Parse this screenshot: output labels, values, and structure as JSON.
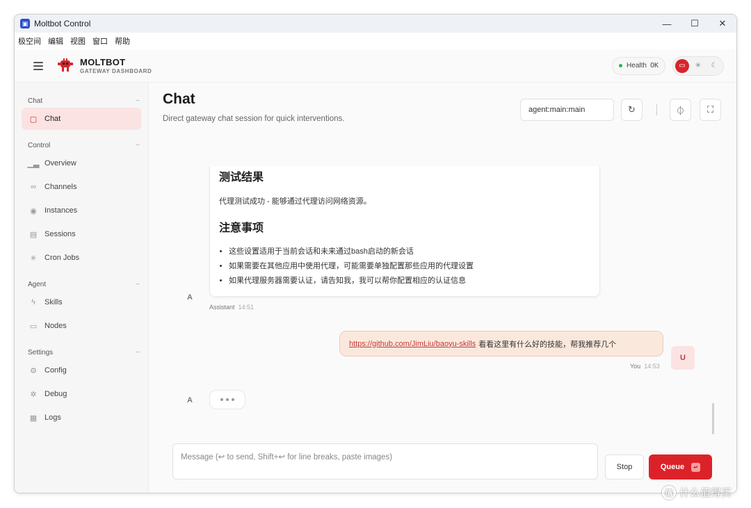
{
  "window": {
    "title": "Moltbot Control",
    "controls": {
      "minimize": "—",
      "maximize": "☐",
      "close": "✕"
    }
  },
  "menubar": [
    "极空间",
    "编辑",
    "视图",
    "窗口",
    "帮助"
  ],
  "header": {
    "brand_name": "MOLTBOT",
    "brand_sub": "GATEWAY DASHBOARD",
    "health_label": "Health",
    "health_status": "OK"
  },
  "sidebar": {
    "sections": [
      {
        "title": "Chat",
        "items": [
          {
            "label": "Chat",
            "icon": "chat-bubble-icon",
            "active": true
          }
        ]
      },
      {
        "title": "Control",
        "items": [
          {
            "label": "Overview",
            "icon": "bar-chart-icon"
          },
          {
            "label": "Channels",
            "icon": "link-icon"
          },
          {
            "label": "Instances",
            "icon": "broadcast-icon"
          },
          {
            "label": "Sessions",
            "icon": "document-icon"
          },
          {
            "label": "Cron Jobs",
            "icon": "spinner-icon"
          }
        ]
      },
      {
        "title": "Agent",
        "items": [
          {
            "label": "Skills",
            "icon": "lightning-icon"
          },
          {
            "label": "Nodes",
            "icon": "monitor-icon"
          }
        ]
      },
      {
        "title": "Settings",
        "items": [
          {
            "label": "Config",
            "icon": "gear-icon"
          },
          {
            "label": "Debug",
            "icon": "bug-icon"
          },
          {
            "label": "Logs",
            "icon": "logs-icon"
          }
        ]
      }
    ]
  },
  "main": {
    "title": "Chat",
    "subtitle": "Direct gateway chat session for quick interventions.",
    "session_key": "agent:main:main"
  },
  "messages": {
    "assistant_card": {
      "heading1": "测试结果",
      "paragraph": "代理测试成功 - 能够通过代理访问网络资源。",
      "heading2": "注意事项",
      "bullets": [
        "这些设置适用于当前会话和未来通过bash启动的新会话",
        "如果需要在其他应用中使用代理，可能需要单独配置那些应用的代理设置",
        "如果代理服务器需要认证，请告知我，我可以帮你配置相应的认证信息"
      ],
      "avatar": "A",
      "sender": "Assistant",
      "time": "14:51"
    },
    "user_message": {
      "link": "https://github.com/JimLiu/baoyu-skills",
      "text": "看看这里有什么好的技能，帮我推荐几个",
      "avatar": "U",
      "sender": "You",
      "time": "14:53"
    },
    "typing_avatar": "A"
  },
  "composer": {
    "placeholder": "Message (↩ to send, Shift+↩ for line breaks, paste images)",
    "stop_label": "Stop",
    "queue_label": "Queue",
    "queue_kbd": "↵"
  },
  "watermark": "什么值得买",
  "colors": {
    "accent": "#dc2229",
    "active_bg": "#fbe3e3",
    "health_dot": "#27b35a",
    "user_bubble": "#fbe8dc"
  }
}
